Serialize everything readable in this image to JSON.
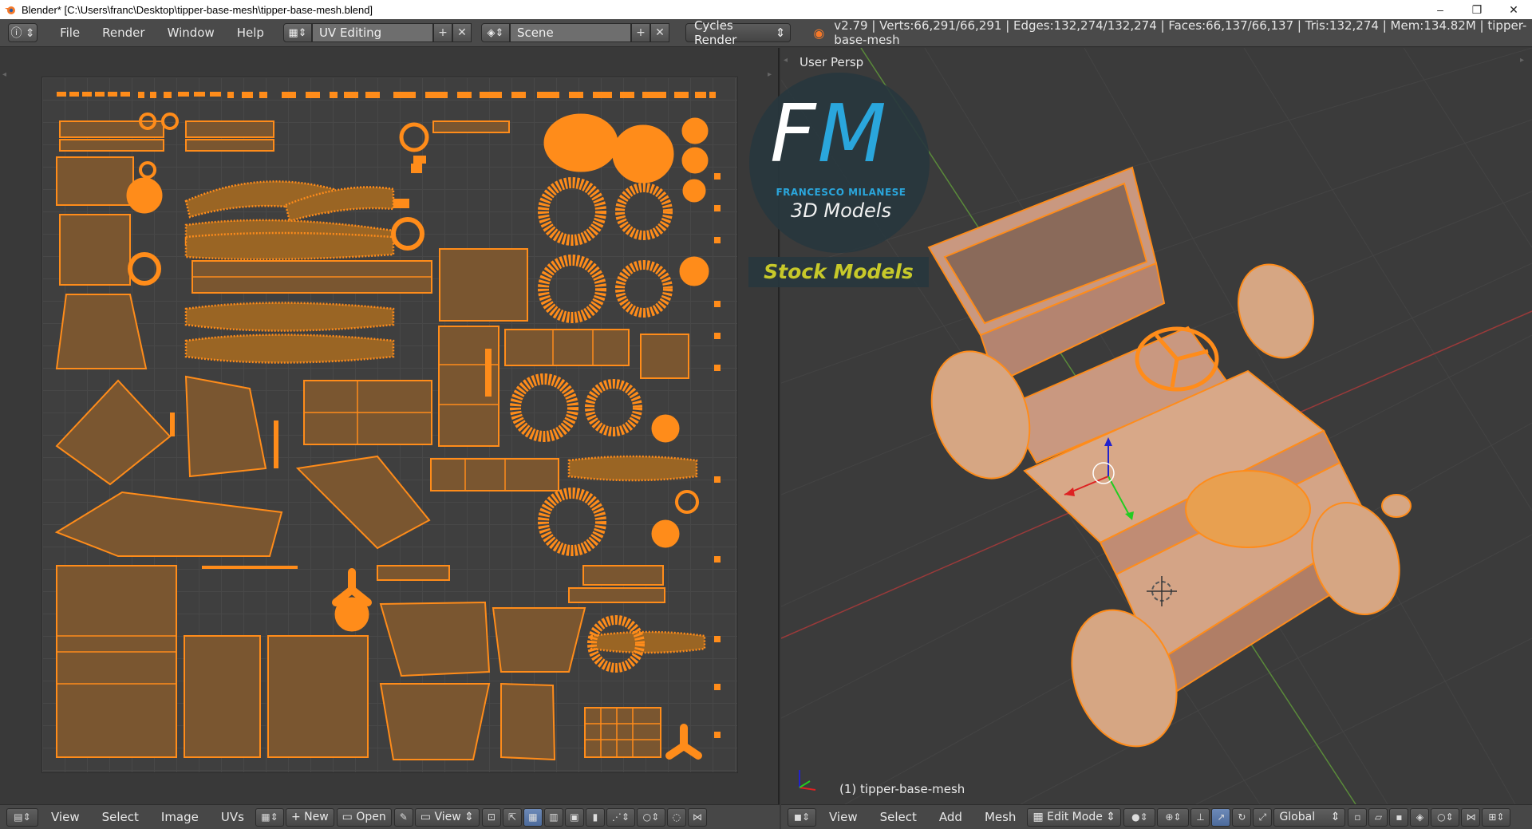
{
  "window": {
    "title": "Blender* [C:\\Users\\franc\\Desktop\\tipper-base-mesh\\tipper-base-mesh.blend]",
    "controls": [
      "–",
      "❐",
      "✕"
    ]
  },
  "info_header": {
    "menu": [
      "File",
      "Render",
      "Window",
      "Help"
    ],
    "screen_layout": "UV Editing",
    "scene": "Scene",
    "render_engine": "Cycles Render",
    "stats": "v2.79 | Verts:66,291/66,291 | Edges:132,274/132,274 | Faces:66,137/66,137 | Tris:132,274 | Mem:134.82M | tipper-base-mesh"
  },
  "uv_editor": {
    "header_menu": [
      "View",
      "Select",
      "Image",
      "UVs"
    ],
    "new_label": "New",
    "open_label": "Open",
    "view_label": "View"
  },
  "viewport": {
    "view_label": "User Persp",
    "object_label": "(1) tipper-base-mesh",
    "header_menu": [
      "View",
      "Select",
      "Add",
      "Mesh"
    ],
    "mode": "Edit Mode",
    "orientation": "Global"
  },
  "overlay_logo": {
    "letters_f": "F",
    "letters_m": "M",
    "subtitle": "FRANCESCO MILANESE",
    "tagline": "3D Models",
    "banner": "Stock Models"
  },
  "colors": {
    "uv_orange": "#ff8c1a",
    "uv_fill": "#7a5630",
    "model_fill": "#d8a888",
    "accent_blue": "#2aa6dc",
    "banner_yellow": "#c7c92a"
  }
}
